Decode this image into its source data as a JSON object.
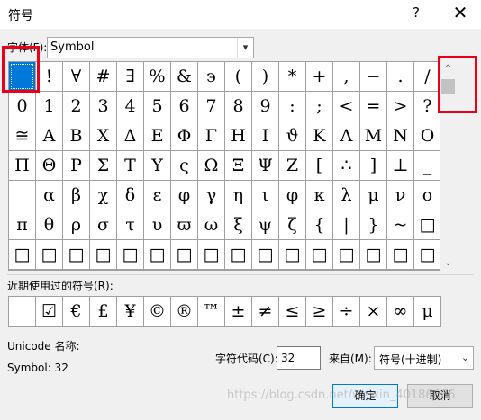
{
  "dialog": {
    "title": "符号",
    "help": "?",
    "close": "✕"
  },
  "font": {
    "label": "字体(F):",
    "value": "Symbol"
  },
  "grid": {
    "rows": [
      [
        "",
        "!",
        "∀",
        "#",
        "∃",
        "%",
        "&",
        "϶",
        "(",
        ")",
        "*",
        "+",
        ",",
        "−",
        ".",
        "/"
      ],
      [
        "0",
        "1",
        "2",
        "3",
        "4",
        "5",
        "6",
        "7",
        "8",
        "9",
        ":",
        ";",
        "<",
        "=",
        ">",
        "?"
      ],
      [
        "≅",
        "Α",
        "Β",
        "Χ",
        "Δ",
        "Ε",
        "Φ",
        "Γ",
        "Η",
        "Ι",
        "ϑ",
        "Κ",
        "Λ",
        "Μ",
        "Ν",
        "Ο"
      ],
      [
        "Π",
        "Θ",
        "Ρ",
        "Σ",
        "Τ",
        "Υ",
        "ς",
        "Ω",
        "Ξ",
        "Ψ",
        "Ζ",
        "[",
        "∴",
        "]",
        "⊥",
        "_"
      ],
      [
        "",
        "α",
        "β",
        "χ",
        "δ",
        "ε",
        "φ",
        "γ",
        "η",
        "ι",
        "φ",
        "κ",
        "λ",
        "μ",
        "ν",
        "ο"
      ],
      [
        "π",
        "θ",
        "ρ",
        "σ",
        "τ",
        "υ",
        "ϖ",
        "ω",
        "ξ",
        "ψ",
        "ζ",
        "{",
        "|",
        "}",
        "~",
        "□"
      ],
      [
        "□",
        "□",
        "□",
        "□",
        "□",
        "□",
        "□",
        "□",
        "□",
        "□",
        "□",
        "□",
        "□",
        "□",
        "□",
        "□"
      ]
    ]
  },
  "scrollbar": {
    "up": "^",
    "down": "⌄"
  },
  "recent": {
    "label": "近期使用过的符号(R):",
    "items": [
      "",
      "☑",
      "€",
      "£",
      "¥",
      "©",
      "®",
      "™",
      "±",
      "≠",
      "≤",
      "≥",
      "÷",
      "×",
      "∞",
      "μ"
    ]
  },
  "unicode": {
    "name_label": "Unicode 名称:",
    "name_value": "Symbol: 32"
  },
  "char_code": {
    "label": "字符代码(C):",
    "value": "32"
  },
  "from": {
    "label": "来自(M):",
    "value": "符号(十进制)"
  },
  "buttons": {
    "ok": "确定",
    "cancel": "取消"
  },
  "watermark": "https://blog.csdn.net/weixin_40186666",
  "colors": {
    "selection": "#0078d7",
    "highlight_box": "#e8001c"
  }
}
